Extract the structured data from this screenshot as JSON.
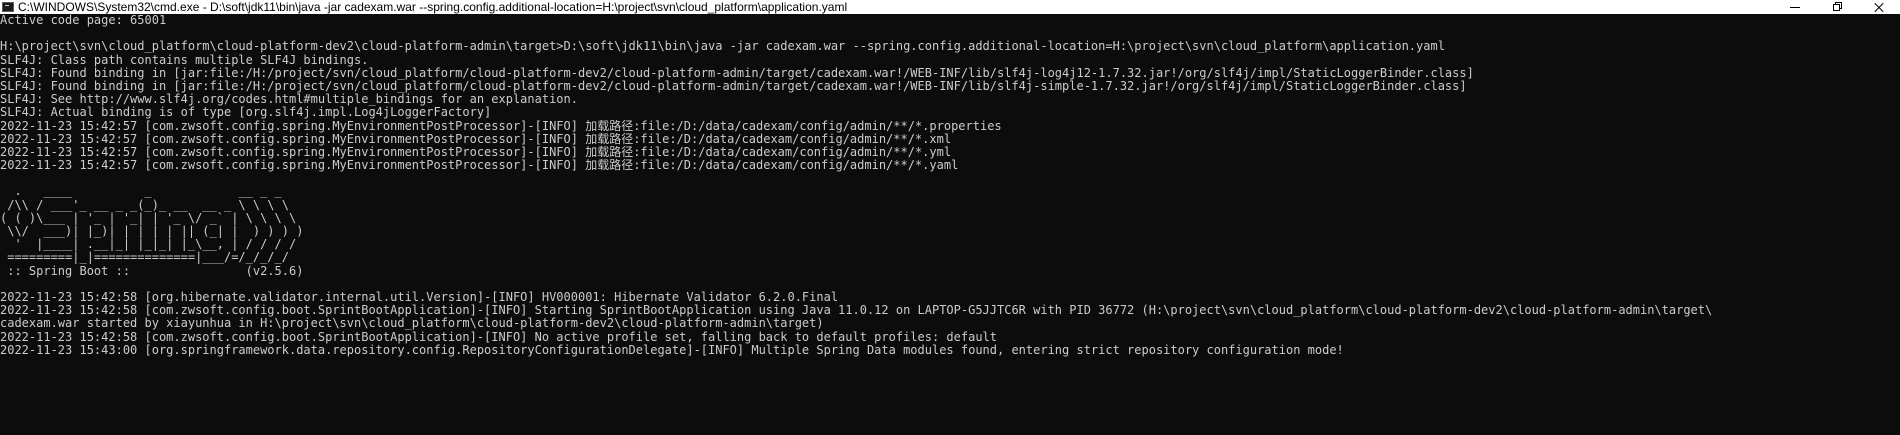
{
  "window": {
    "title": "C:\\WINDOWS\\System32\\cmd.exe - D:\\soft\\jdk11\\bin\\java  -jar cadexam.war --spring.config.additional-location=H:\\project\\svn\\cloud_platform\\application.yaml",
    "icon": "cmd-icon",
    "controls": [
      "minimize-icon",
      "maximize-icon",
      "close-icon"
    ]
  },
  "console": {
    "lines": [
      "Active code page: 65001",
      "",
      "H:\\project\\svn\\cloud_platform\\cloud-platform-dev2\\cloud-platform-admin\\target>D:\\soft\\jdk11\\bin\\java -jar cadexam.war --spring.config.additional-location=H:\\project\\svn\\cloud_platform\\application.yaml",
      "SLF4J: Class path contains multiple SLF4J bindings.",
      "SLF4J: Found binding in [jar:file:/H:/project/svn/cloud_platform/cloud-platform-dev2/cloud-platform-admin/target/cadexam.war!/WEB-INF/lib/slf4j-log4j12-1.7.32.jar!/org/slf4j/impl/StaticLoggerBinder.class]",
      "SLF4J: Found binding in [jar:file:/H:/project/svn/cloud_platform/cloud-platform-dev2/cloud-platform-admin/target/cadexam.war!/WEB-INF/lib/slf4j-simple-1.7.32.jar!/org/slf4j/impl/StaticLoggerBinder.class]",
      "SLF4J: See http://www.slf4j.org/codes.html#multiple_bindings for an explanation.",
      "SLF4J: Actual binding is of type [org.slf4j.impl.Log4jLoggerFactory]",
      "2022-11-23 15:42:57 [com.zwsoft.config.spring.MyEnvironmentPostProcessor]-[INFO] 加载路径:file:/D:/data/cadexam/config/admin/**/*.properties",
      "2022-11-23 15:42:57 [com.zwsoft.config.spring.MyEnvironmentPostProcessor]-[INFO] 加载路径:file:/D:/data/cadexam/config/admin/**/*.xml",
      "2022-11-23 15:42:57 [com.zwsoft.config.spring.MyEnvironmentPostProcessor]-[INFO] 加载路径:file:/D:/data/cadexam/config/admin/**/*.yml",
      "2022-11-23 15:42:57 [com.zwsoft.config.spring.MyEnvironmentPostProcessor]-[INFO] 加载路径:file:/D:/data/cadexam/config/admin/**/*.yaml",
      "",
      "  .   ____          _            __ _ _",
      " /\\\\ / ___'_ __ _ _(_)_ __  __ _ \\ \\ \\ \\",
      "( ( )\\___ | '_ | '_| | '_ \\/ _` | \\ \\ \\ \\",
      " \\\\/  ___)| |_)| | | | | || (_| |  ) ) ) )",
      "  '  |____| .__|_| |_|_| |_\\__, | / / / /",
      " =========|_|==============|___/=/_/_/_/",
      " :: Spring Boot ::                (v2.5.6)",
      "",
      "2022-11-23 15:42:58 [org.hibernate.validator.internal.util.Version]-[INFO] HV000001: Hibernate Validator 6.2.0.Final",
      "2022-11-23 15:42:58 [com.zwsoft.config.boot.SprintBootApplication]-[INFO] Starting SprintBootApplication using Java 11.0.12 on LAPTOP-G5JJTC6R with PID 36772 (H:\\project\\svn\\cloud_platform\\cloud-platform-dev2\\cloud-platform-admin\\target\\",
      "cadexam.war started by xiayunhua in H:\\project\\svn\\cloud_platform\\cloud-platform-dev2\\cloud-platform-admin\\target)",
      "2022-11-23 15:42:58 [com.zwsoft.config.boot.SprintBootApplication]-[INFO] No active profile set, falling back to default profiles: default",
      "2022-11-23 15:43:00 [org.springframework.data.repository.config.RepositoryConfigurationDelegate]-[INFO] Multiple Spring Data modules found, entering strict repository configuration mode!"
    ]
  },
  "colors": {
    "background": "#0c0c0c",
    "text": "#cccccc",
    "titlebar": "#ffffff"
  }
}
